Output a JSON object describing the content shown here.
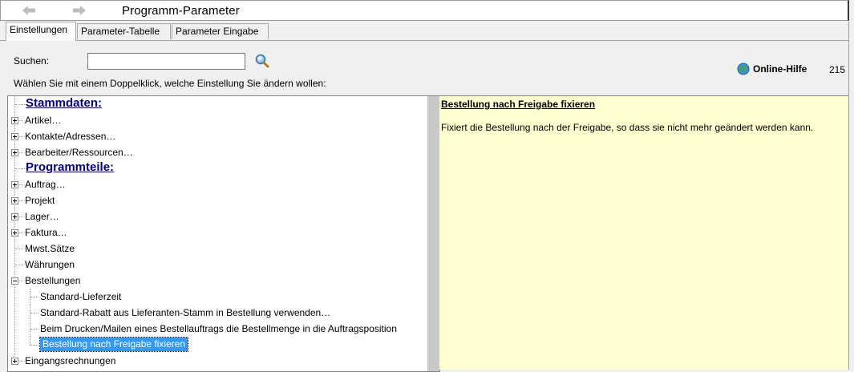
{
  "window": {
    "title": "Programm-Parameter"
  },
  "tabs": [
    {
      "label": "Einstellungen",
      "active": true
    },
    {
      "label": "Parameter-Tabelle",
      "active": false
    },
    {
      "label": "Parameter Eingabe",
      "active": false
    }
  ],
  "search": {
    "label": "Suchen:",
    "value": "",
    "placeholder": ""
  },
  "help": {
    "label": "Online-Hilfe",
    "count": "215"
  },
  "instruction": "Wählen Sie mit einem Doppelklick, welche Einstellung Sie ändern wollen:",
  "tree": [
    {
      "label": "Stammdaten:",
      "kind": "heading"
    },
    {
      "label": "Artikel…",
      "kind": "collapsed"
    },
    {
      "label": "Kontakte/Adressen…",
      "kind": "collapsed"
    },
    {
      "label": "Bearbeiter/Ressourcen…",
      "kind": "collapsed"
    },
    {
      "label": "Programmteile:",
      "kind": "heading"
    },
    {
      "label": "Auftrag…",
      "kind": "collapsed"
    },
    {
      "label": "Projekt",
      "kind": "collapsed"
    },
    {
      "label": "Lager…",
      "kind": "collapsed"
    },
    {
      "label": "Faktura…",
      "kind": "collapsed"
    },
    {
      "label": "Mwst.Sätze",
      "kind": "leaf"
    },
    {
      "label": "Währungen",
      "kind": "leaf"
    },
    {
      "label": "Bestellungen",
      "kind": "expanded"
    },
    {
      "label": "Standard-Lieferzeit",
      "kind": "child"
    },
    {
      "label": "Standard-Rabatt aus Lieferanten-Stamm in Bestellung verwenden…",
      "kind": "child"
    },
    {
      "label": "Beim Drucken/Mailen eines Bestellauftrags die Bestellmenge in die Auftragsposition",
      "kind": "child"
    },
    {
      "label": "Bestellung nach Freigabe fixieren",
      "kind": "child",
      "selected": true
    },
    {
      "label": "Eingangsrechnungen",
      "kind": "collapsed"
    }
  ],
  "info": {
    "title": "Bestellung nach Freigabe fixieren",
    "description": "Fixiert die Bestellung nach der Freigabe, so dass sie nicht mehr geändert werden kann."
  },
  "colors": {
    "info_background": "#ffffd0",
    "heading_text": "#00008b",
    "selection": "#3399ff"
  },
  "icons": {
    "back": "arrow-left-icon",
    "forward": "arrow-right-icon",
    "search": "magnifier-icon",
    "help": "globe-icon"
  }
}
